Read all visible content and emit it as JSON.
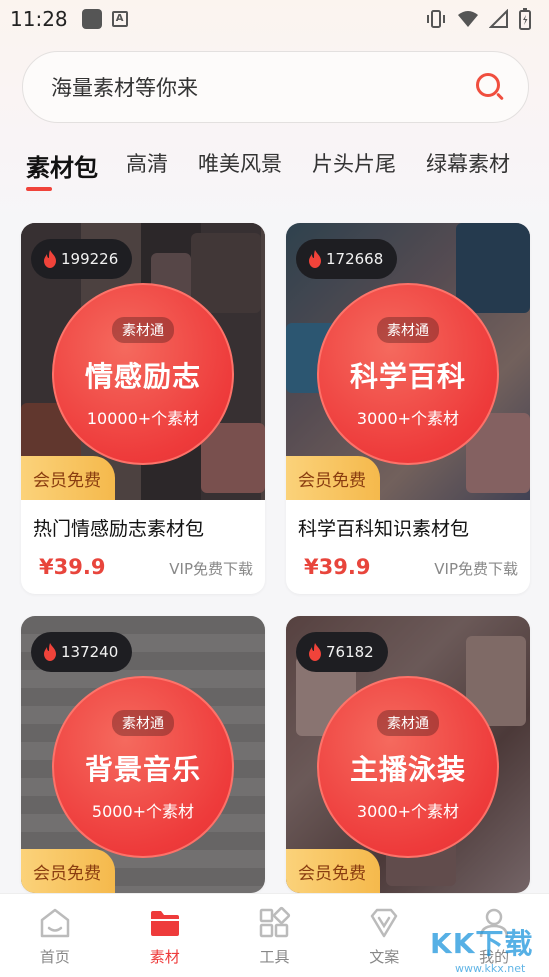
{
  "status_bar": {
    "time": "11:28"
  },
  "search": {
    "placeholder": "海量素材等你来"
  },
  "tabs": [
    {
      "label": "素材包",
      "active": true
    },
    {
      "label": "高清"
    },
    {
      "label": "唯美风景"
    },
    {
      "label": "片头片尾"
    },
    {
      "label": "绿幕素材"
    }
  ],
  "cards": [
    {
      "views": "199226",
      "tag": "素材通",
      "title": "情感励志",
      "count": "10000+个素材",
      "member": "会员免费",
      "name": "热门情感励志素材包",
      "price": "¥39.9",
      "download": "VIP免费下载"
    },
    {
      "views": "172668",
      "tag": "素材通",
      "title": "科学百科",
      "count": "3000+个素材",
      "member": "会员免费",
      "name": "科学百科知识素材包",
      "price": "¥39.9",
      "download": "VIP免费下载"
    },
    {
      "views": "137240",
      "tag": "素材通",
      "title": "背景音乐",
      "count": "5000+个素材",
      "member": "会员免费"
    },
    {
      "views": "76182",
      "tag": "素材通",
      "title": "主播泳装",
      "count": "3000+个素材",
      "member": "会员免费"
    }
  ],
  "bottom_nav": [
    {
      "label": "首页",
      "icon": "home-icon"
    },
    {
      "label": "素材",
      "icon": "folder-icon",
      "active": true
    },
    {
      "label": "工具",
      "icon": "grid-icon"
    },
    {
      "label": "文案",
      "icon": "diamond-icon"
    },
    {
      "label": "我的",
      "icon": "user-icon"
    }
  ],
  "watermark": {
    "text": "KK下载",
    "url": "www.kkx.net"
  },
  "colors": {
    "accent": "#ee3b3b",
    "member_bg": "#f5b94c"
  }
}
